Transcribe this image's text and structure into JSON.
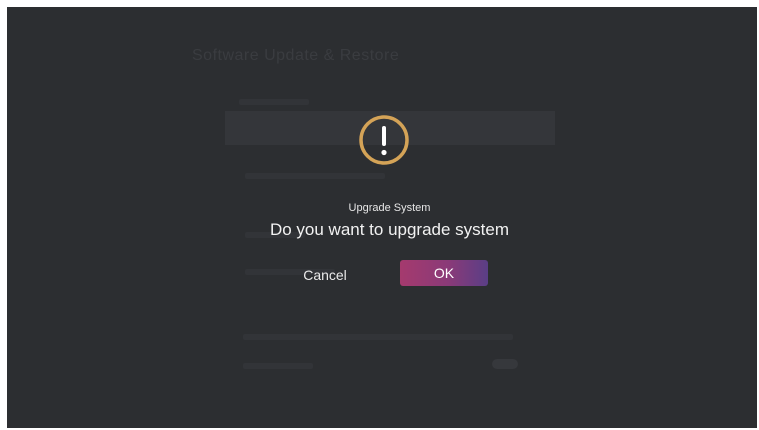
{
  "background": {
    "title": "Software Update & Restore"
  },
  "dialog": {
    "icon": "warning-exclamation-icon",
    "icon_color": "#d4a357",
    "title": "Upgrade System",
    "message": "Do you want to upgrade system",
    "buttons": {
      "cancel_label": "Cancel",
      "ok_label": "OK"
    },
    "ok_gradient": [
      "#a53a6e",
      "#5a3e86"
    ]
  },
  "colors": {
    "screen_bg": "#2c2e31",
    "text": "#f2f2f2"
  }
}
